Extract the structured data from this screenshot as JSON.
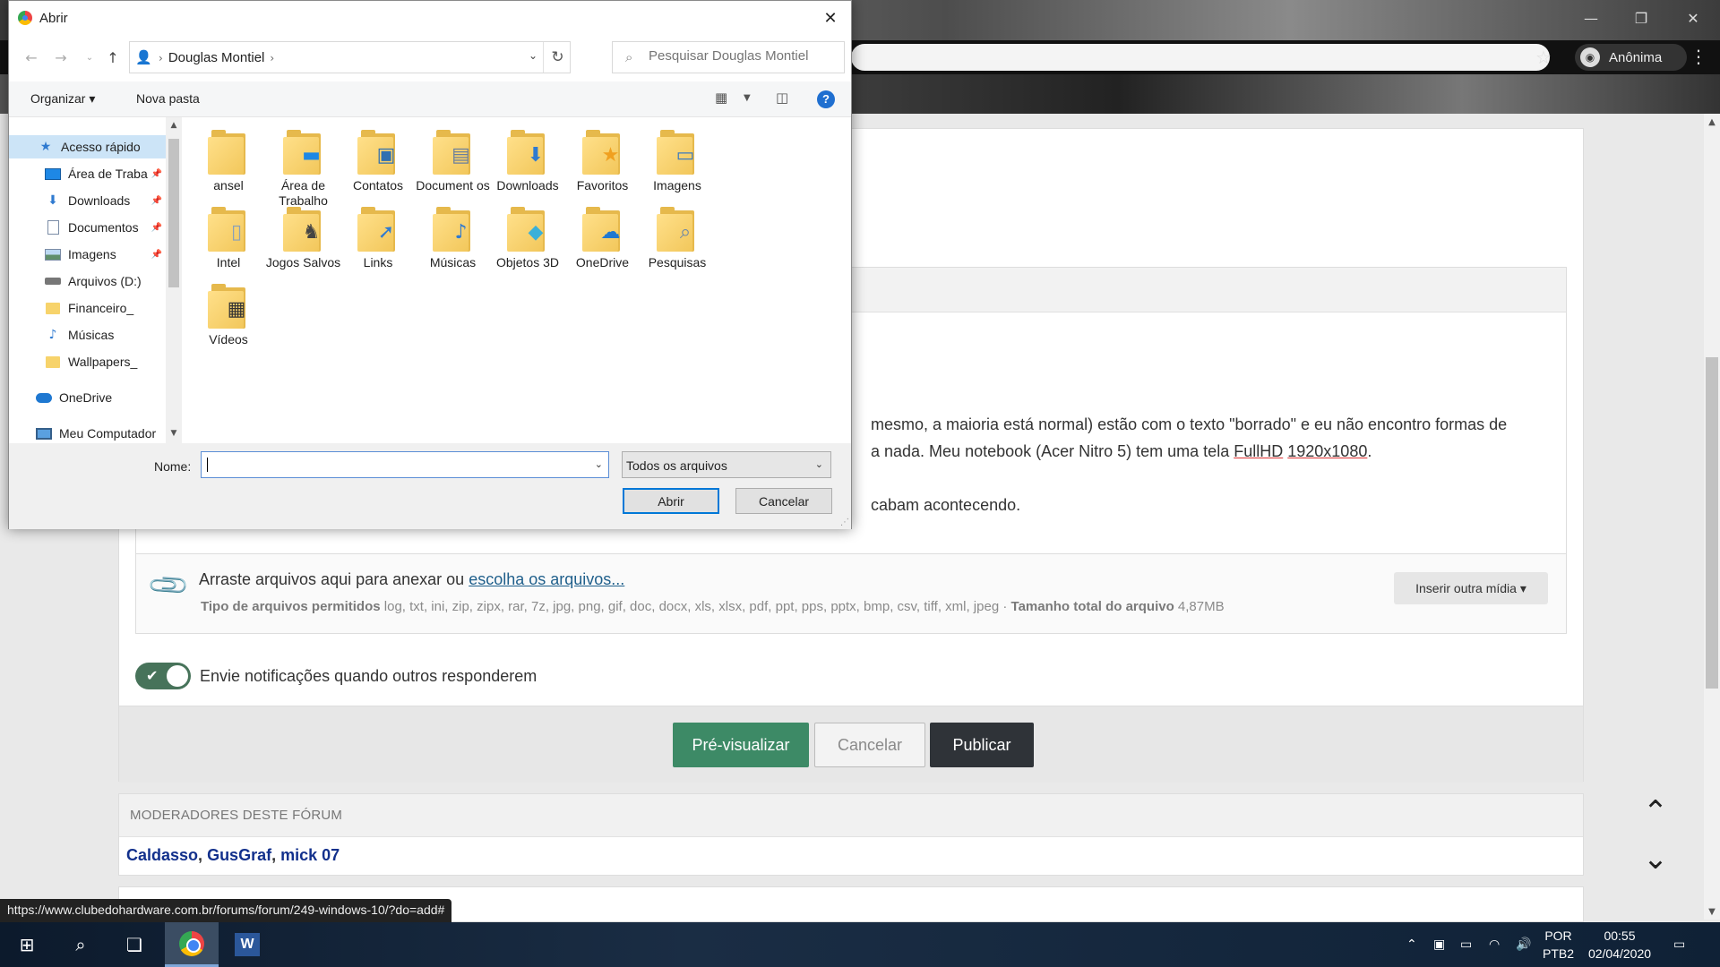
{
  "browser": {
    "profile_label": "Anônima",
    "status_url": "https://www.clubedohardware.com.br/forums/forum/249-windows-10/?do=add#"
  },
  "page": {
    "body_lines": [
      "mesmo, a maioria está normal) estão com o texto \"borrado\" e eu não encontro formas de",
      "a nada. Meu notebook (Acer Nitro 5) tem uma tela",
      "FullHD",
      "1920x1080",
      ".",
      "cabam acontecendo."
    ],
    "attach": {
      "main_text": "Arraste arquivos aqui para anexar ou",
      "link_text": "escolha os arquivos...",
      "types_label": "Tipo de arquivos permitidos",
      "types_list": "log, txt, ini, zip, zipx, rar, 7z, jpg, png, gif, doc, docx, xls, xlsx, pdf, ppt, pps, pptx, bmp, csv, tiff, xml, jpeg",
      "separator": "·",
      "size_label": "Tamanho total do arquivo",
      "size_value": "4,87MB",
      "insert_button": "Inserir outra mídia ▾"
    },
    "notify_label": "Envie notificações quando outros responderem",
    "buttons": {
      "preview": "Pré-visualizar",
      "cancel": "Cancelar",
      "publish": "Publicar"
    },
    "moderators": {
      "heading": "MODERADORES DESTE FÓRUM",
      "names": [
        "Caldasso",
        "GusGraf",
        "mick 07"
      ],
      "separator": ", "
    }
  },
  "taskbar": {
    "language": "POR",
    "layout": "PTB2",
    "time": "00:55",
    "date": "02/04/2020"
  },
  "dialog": {
    "title": "Abrir",
    "address": {
      "crumbs": [
        "Douglas Montiel"
      ]
    },
    "search_placeholder": "Pesquisar Douglas Montiel",
    "commands": {
      "organize": "Organizar ▾",
      "new_folder": "Nova pasta"
    },
    "nav_items": [
      {
        "label": "Acesso rápido",
        "icon": "star-icon",
        "selected": true
      },
      {
        "label": "Área de Traba",
        "icon": "desktop-icon",
        "pinned": true
      },
      {
        "label": "Downloads",
        "icon": "download-icon",
        "pinned": true
      },
      {
        "label": "Documentos",
        "icon": "documents-icon",
        "pinned": true
      },
      {
        "label": "Imagens",
        "icon": "pictures-icon",
        "pinned": true
      },
      {
        "label": "Arquivos (D:)",
        "icon": "drive-icon"
      },
      {
        "label": "Financeiro_",
        "icon": "folder-icon"
      },
      {
        "label": "Músicas",
        "icon": "music-icon"
      },
      {
        "label": "Wallpapers_",
        "icon": "folder-icon"
      },
      {
        "label": "OneDrive",
        "icon": "cloud-icon"
      },
      {
        "label": "Meu Computador",
        "icon": "computer-icon"
      }
    ],
    "files": [
      {
        "name": "ansel",
        "overlay": ""
      },
      {
        "name": "Área de Trabalho",
        "overlay": "desktop"
      },
      {
        "name": "Contatos",
        "overlay": "contacts"
      },
      {
        "name": "Document os",
        "overlay": "documents"
      },
      {
        "name": "Downloads",
        "overlay": "download"
      },
      {
        "name": "Favoritos",
        "overlay": "star"
      },
      {
        "name": "Imagens",
        "overlay": "pictures"
      },
      {
        "name": "Intel",
        "overlay": "paper"
      },
      {
        "name": "Jogos Salvos",
        "overlay": "chess"
      },
      {
        "name": "Links",
        "overlay": "link"
      },
      {
        "name": "Músicas",
        "overlay": "music"
      },
      {
        "name": "Objetos 3D",
        "overlay": "cube"
      },
      {
        "name": "OneDrive",
        "overlay": "cloud"
      },
      {
        "name": "Pesquisas",
        "overlay": "search"
      },
      {
        "name": "Vídeos",
        "overlay": "film"
      }
    ],
    "name_label": "Nome:",
    "name_value": "",
    "file_type": "Todos os arquivos",
    "open_button": "Abrir",
    "cancel_button": "Cancelar"
  }
}
